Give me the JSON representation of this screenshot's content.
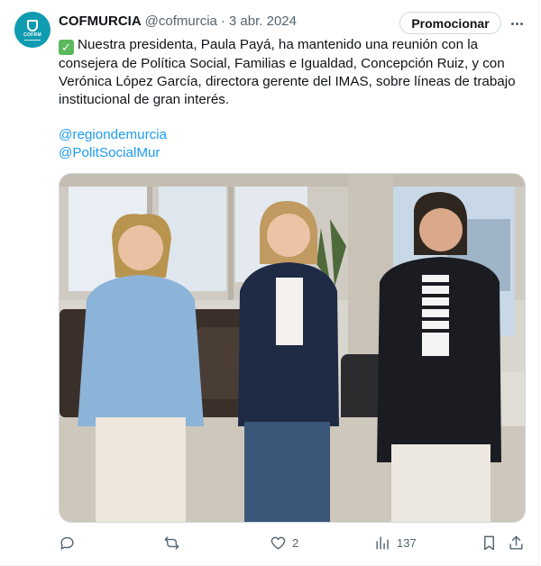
{
  "account": {
    "name": "COFMURCIA",
    "handle": "@cofmurcia",
    "separator": "·",
    "date": "3 abr. 2024",
    "avatar_text": "COFRM"
  },
  "promote_label": "Promocionar",
  "tweet": {
    "lines": [
      "Nuestra presidenta, Paula Payá, ha mantenido una reunión con la",
      "consejera de Política Social, Familias e Igualdad, Concepción Ruiz, y con",
      "Verónica López García, directora gerente del IMAS, sobre líneas de trabajo",
      "institucional de gran interés."
    ],
    "mentions": [
      "@regiondemurcia",
      "@PolitSocialMur"
    ]
  },
  "photo": {
    "description_icon": "photo-three-women-office"
  },
  "actions": {
    "reply_count": "",
    "retweet_count": "",
    "like_count": "2",
    "views_count": "137"
  },
  "colors": {
    "accent": "#1d9bf0",
    "avatar": "#0f9bb0",
    "check": "#5cb85c",
    "muted": "#536471"
  }
}
